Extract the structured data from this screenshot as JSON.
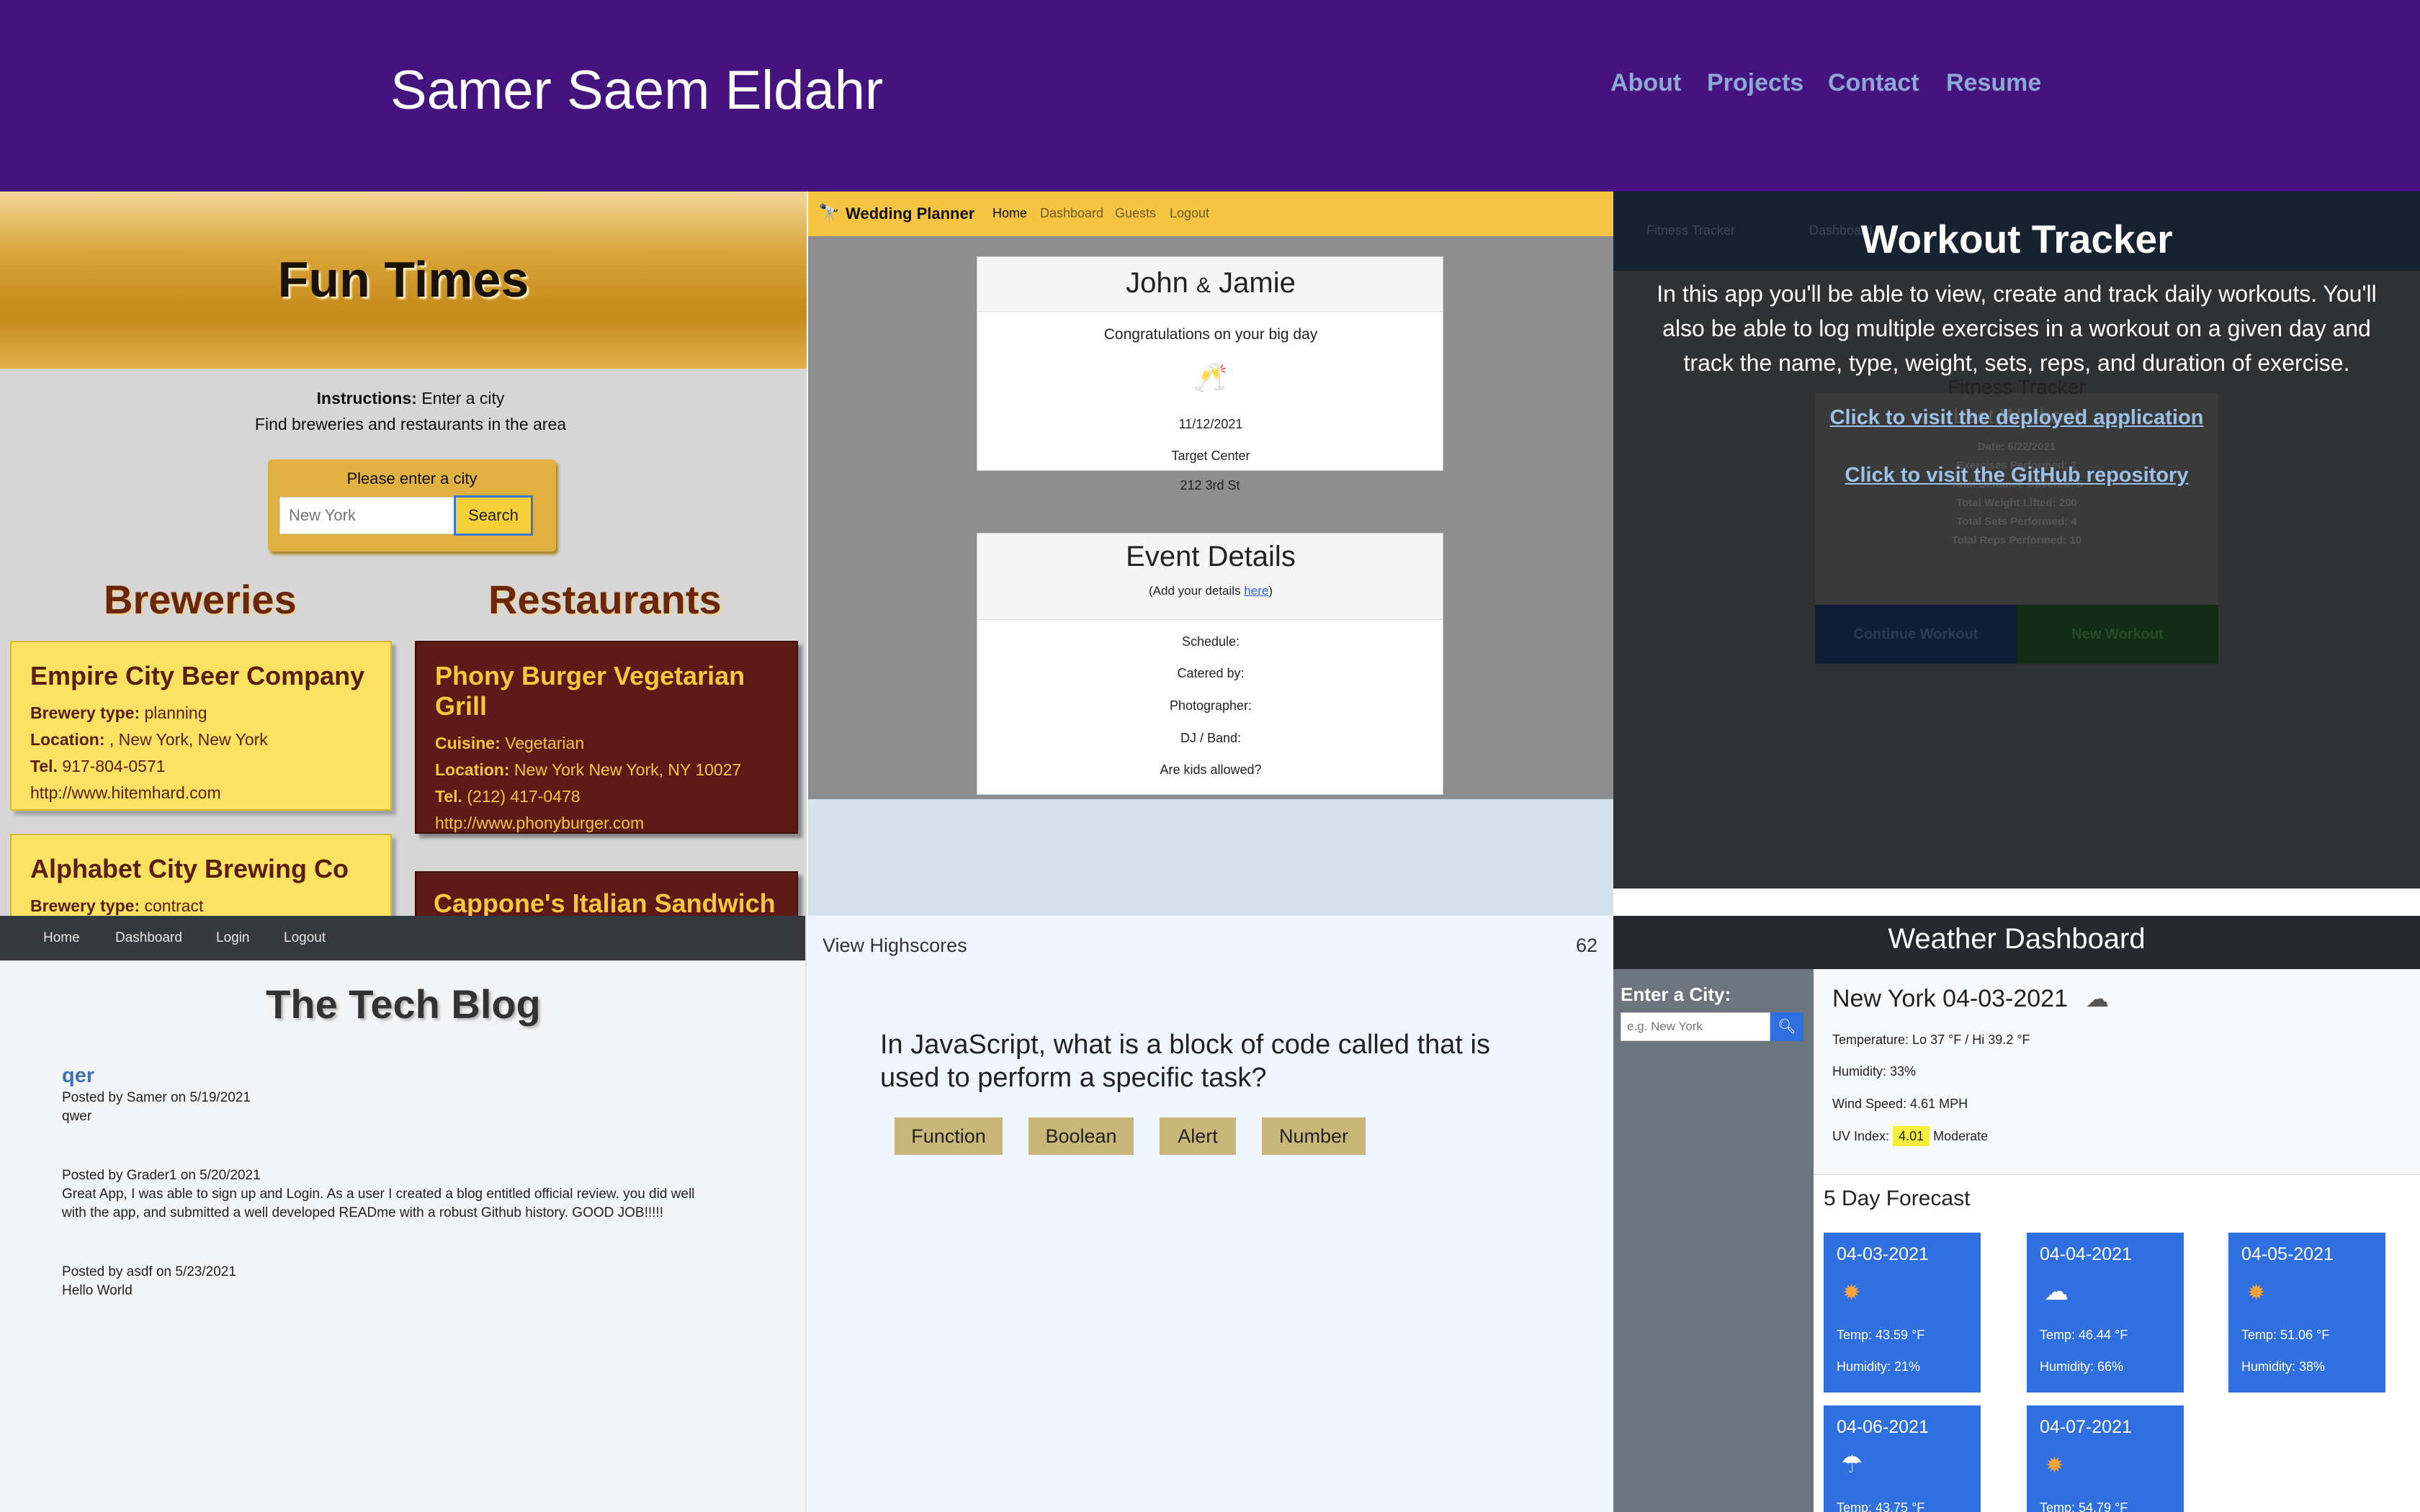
{
  "header": {
    "title": "Samer Saem Eldahr",
    "nav": [
      "About",
      "Projects",
      "Contact",
      "Resume"
    ],
    "bg_color": "#45137e"
  },
  "fun_times": {
    "title": "Fun Times",
    "instructions_label": "Instructions:",
    "instructions_text": "Enter a city",
    "subtext": "Find breweries and restaurants in the area",
    "search_label": "Please enter a city",
    "search_placeholder": "New York",
    "search_button": "Search",
    "breweries_heading": "Breweries",
    "restaurants_heading": "Restaurants",
    "breweries": [
      {
        "name": "Empire City Beer Company",
        "type_label": "Brewery type:",
        "type": "planning",
        "location_label": "Location:",
        "location": ", New York, New York",
        "tel_label": "Tel.",
        "tel": "917-804-0571",
        "url": "http://www.hitemhard.com"
      },
      {
        "name": "Alphabet City Brewing Co",
        "type_label": "Brewery type:",
        "type": "contract"
      }
    ],
    "restaurants": [
      {
        "name_line1": "Phony Burger Vegetarian",
        "name_line2": "Grill",
        "cuisine_label": "Cuisine:",
        "cuisine": "Vegetarian",
        "location_label": "Location:",
        "location": "New York New York, NY 10027",
        "tel_label": "Tel.",
        "tel": "(212) 417-0478",
        "url": "http://www.phonyburger.com"
      },
      {
        "name": "Cappone's Italian Sandwich"
      }
    ]
  },
  "wedding_planner": {
    "brand_icon": "binoculars-icon",
    "brand": "Wedding Planner",
    "nav": [
      "Home",
      "Dashboard",
      "Guests",
      "Logout"
    ],
    "couple_name_1": "John",
    "couple_amp": "&",
    "couple_name_2": "Jamie",
    "congrats": "Congratulations on your big day",
    "toast_icon": "champagne-glasses-icon",
    "date": "11/12/2021",
    "venue": "Target Center",
    "address": "212 3rd St",
    "event_heading": "Event Details",
    "add_details_prefix": "(Add your details",
    "add_details_link": "here",
    "add_details_suffix": ")",
    "fields": [
      "Schedule:",
      "Catered by:",
      "Photographer:",
      "DJ / Band:",
      "Are kids allowed?"
    ]
  },
  "workout_tracker": {
    "title": "Workout Tracker",
    "description": "In this app you'll be able to view, create and track daily workouts. You'll also be able to log multiple exercises in a workout on a given day and track the name, type, weight, sets, reps, and duration of exercise.",
    "deployed_link": "Click to visit the deployed application",
    "repo_link": "Click to visit the GitHub repository",
    "bg_nav": [
      "Fitness Tracker",
      "Dashboard"
    ],
    "bg_heading": "Fitness Tracker",
    "bg_subheading": "Last Workout",
    "bg_stats": [
      "Date: 6/22/2021",
      "Exercises Performed: 2",
      "Total Distance Covered: 5",
      "Total Weight Lifted: 200",
      "Total Sets Performed: 4",
      "Total Reps Performed: 10"
    ],
    "bg_buttons": [
      "Continue Workout",
      "New Workout"
    ]
  },
  "tech_blog": {
    "nav": [
      "Home",
      "Dashboard",
      "Login",
      "Logout"
    ],
    "title": "The Tech Blog",
    "post_title": "qer",
    "post_meta": "Posted by Samer on 5/19/2021",
    "post_body": "qwer",
    "comments": [
      {
        "meta": "Posted by Grader1 on 5/20/2021",
        "line1": "Great App, I was able to sign up and Login. As a user I created a blog entitled official review. you did well",
        "line2": "with the app, and submitted a well developed READme with a robust Github history. GOOD JOB!!!!!"
      },
      {
        "meta": "Posted by asdf on 5/23/2021",
        "line1": "Hello World"
      }
    ]
  },
  "quiz": {
    "highscores_link": "View Highscores",
    "timer": "62",
    "question_line1": "In JavaScript, what is a block of code called that is",
    "question_line2": "used to perform a specific task?",
    "answers": [
      "Function",
      "Boolean",
      "Alert",
      "Number"
    ]
  },
  "weather": {
    "title": "Weather Dashboard",
    "city_label": "Enter a City:",
    "city_placeholder": "e.g. New York",
    "search_icon": "search-icon",
    "current_title": "New York 04-03-2021",
    "current_icon": "wind-cloud-icon",
    "temperature": "Temperature: Lo 37 °F / Hi 39.2 °F",
    "humidity": "Humidity: 33%",
    "wind": "Wind Speed: 4.61 MPH",
    "uv_label": "UV Index:",
    "uv_value": "4.01",
    "uv_desc": "Moderate",
    "uv_color": "#f7ef3d",
    "forecast_heading": "5 Day Forecast",
    "forecast": [
      {
        "date": "04-03-2021",
        "icon": "sun-icon",
        "temp": "Temp: 43.59 °F",
        "humidity": "Humidity: 21%"
      },
      {
        "date": "04-04-2021",
        "icon": "cloud-icon",
        "temp": "Temp: 46.44 °F",
        "humidity": "Humidity: 66%"
      },
      {
        "date": "04-05-2021",
        "icon": "sun-icon",
        "temp": "Temp: 51.06 °F",
        "humidity": "Humidity: 38%"
      },
      {
        "date": "04-06-2021",
        "icon": "rain-cloud-icon",
        "temp": "Temp: 43.75 °F"
      },
      {
        "date": "04-07-2021",
        "icon": "sun-icon",
        "temp": "Temp: 54.79 °F"
      }
    ]
  }
}
